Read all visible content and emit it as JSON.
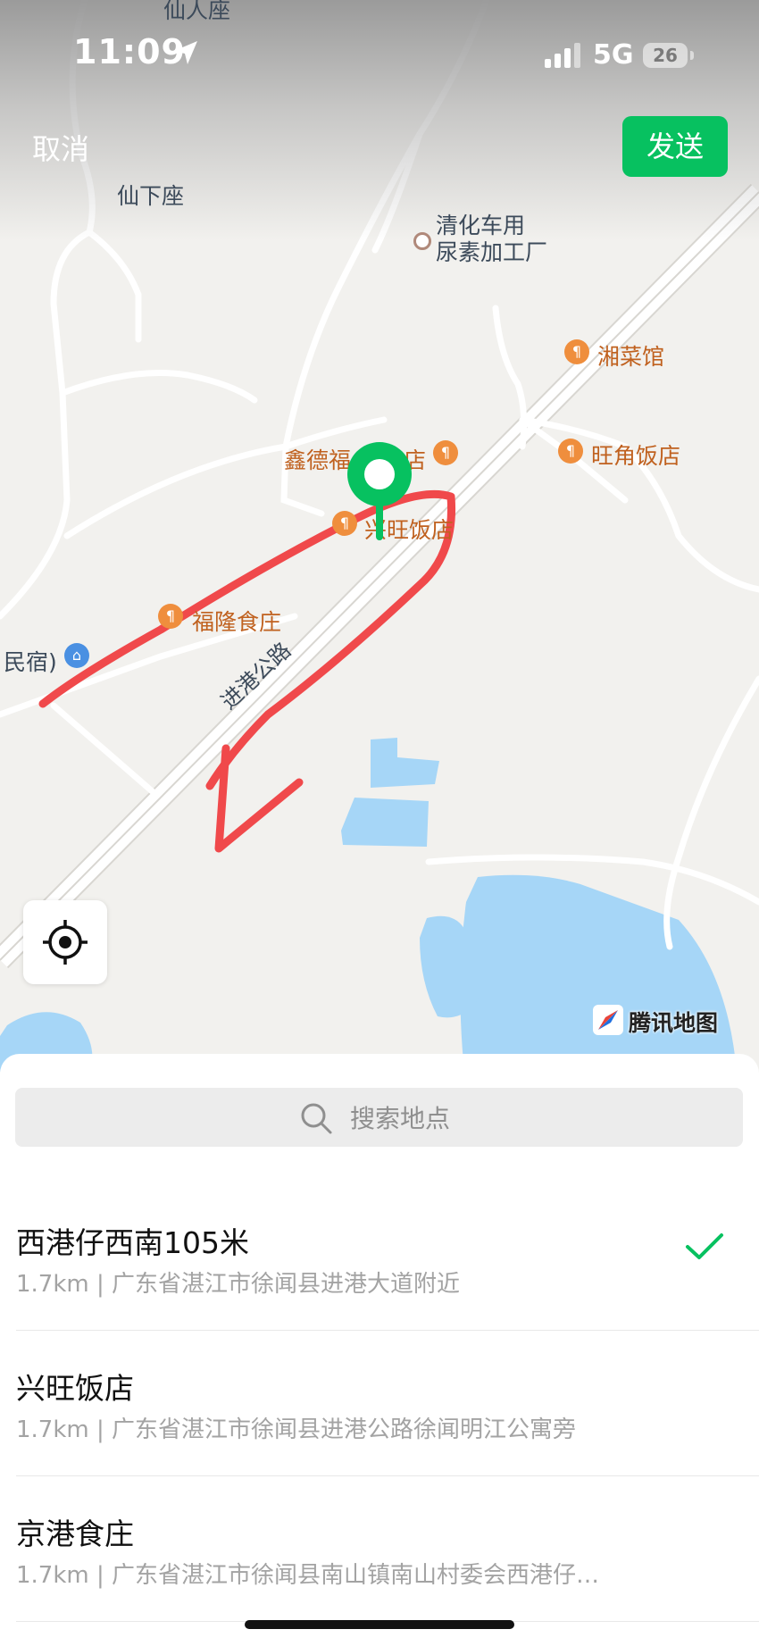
{
  "status_bar": {
    "time": "11:09",
    "network": "5G",
    "battery": "26",
    "icons": [
      "location-arrow-icon",
      "signal-bars-icon",
      "battery-icon"
    ]
  },
  "header": {
    "cancel_label": "取消",
    "send_label": "发送",
    "send_color": "#07c160"
  },
  "map": {
    "place_labels": {
      "xianrenzuo": "仙人座",
      "xianxiazuo": "仙下座",
      "factory": "清化车用\n尿素加工厂"
    },
    "pois": {
      "xiangcaiguan": "湘菜馆",
      "wangjiao": "旺角饭店",
      "xinde": "鑫德福",
      "xinde_tail": "店",
      "xingwang": "兴旺饭店",
      "fulong": "福隆食庄",
      "minsu": "民宿)"
    },
    "road_label": "进港公路",
    "provider": "腾讯地图",
    "water_color": "#a6d6f7",
    "annotation_color": "#f0494b",
    "pin_color": "#07c160"
  },
  "search": {
    "placeholder": "搜索地点"
  },
  "results": [
    {
      "name": "西港仔西南105米",
      "address": "1.7km | 广东省湛江市徐闻县进港大道附近",
      "selected": true
    },
    {
      "name": "兴旺饭店",
      "address": "1.7km | 广东省湛江市徐闻县进港公路徐闻明江公寓旁",
      "selected": false
    },
    {
      "name": "京港食庄",
      "address": "1.7km | 广东省湛江市徐闻县南山镇南山村委会西港仔…",
      "selected": false
    }
  ]
}
